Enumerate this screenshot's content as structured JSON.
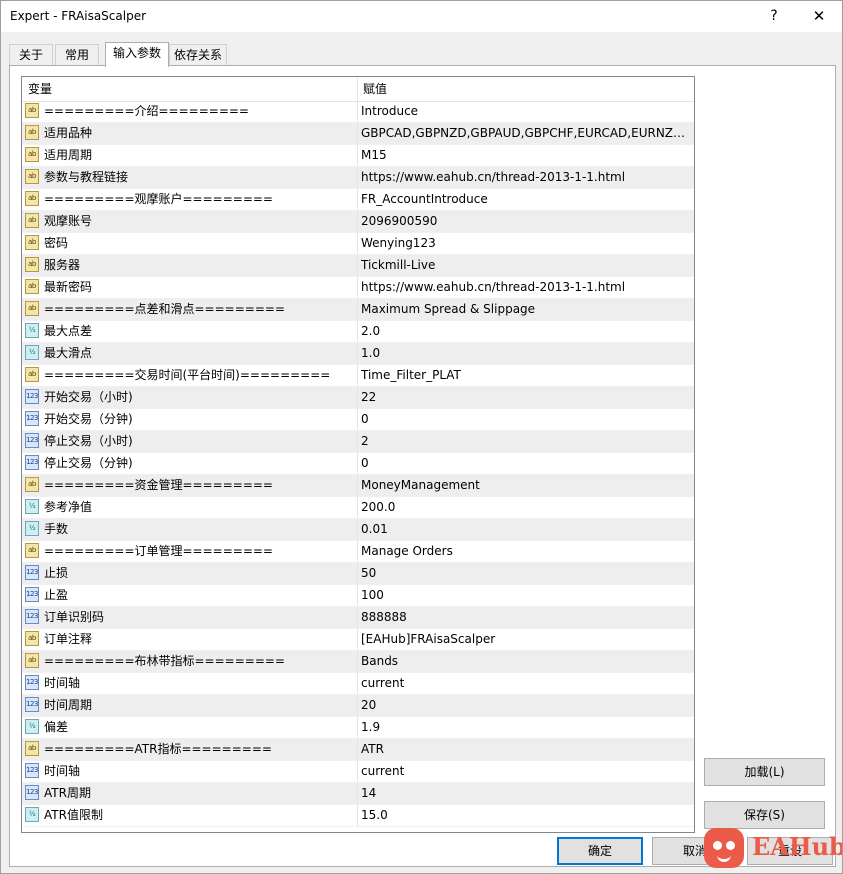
{
  "window": {
    "title": "Expert - FRAisaScalper",
    "help": "?",
    "close": "✕"
  },
  "tabs": [
    {
      "label": "关于"
    },
    {
      "label": "常用"
    },
    {
      "label": "输入参数",
      "active": true
    },
    {
      "label": "依存关系"
    }
  ],
  "grid": {
    "col_variable": "变量",
    "col_value": "赋值",
    "rows": [
      {
        "type": "str",
        "name": "=========介绍=========",
        "value": "Introduce"
      },
      {
        "type": "str",
        "name": "适用品种",
        "value": "GBPCAD,GBPNZD,GBPAUD,GBPCHF,EURCAD,EURNZD,..."
      },
      {
        "type": "str",
        "name": "适用周期",
        "value": "M15"
      },
      {
        "type": "str",
        "name": "参数与教程链接",
        "value": "https://www.eahub.cn/thread-2013-1-1.html"
      },
      {
        "type": "str",
        "name": "=========观摩账户=========",
        "value": "FR_AccountIntroduce"
      },
      {
        "type": "str",
        "name": "观摩账号",
        "value": "2096900590"
      },
      {
        "type": "str",
        "name": "密码",
        "value": "Wenying123"
      },
      {
        "type": "str",
        "name": "服务器",
        "value": "Tickmill-Live"
      },
      {
        "type": "str",
        "name": "最新密码",
        "value": "https://www.eahub.cn/thread-2013-1-1.html"
      },
      {
        "type": "str",
        "name": "=========点差和滑点=========",
        "value": "Maximum Spread & Slippage"
      },
      {
        "type": "dbl",
        "name": "最大点差",
        "value": "2.0"
      },
      {
        "type": "dbl",
        "name": "最大滑点",
        "value": "1.0"
      },
      {
        "type": "str",
        "name": "=========交易时间(平台时间)=========",
        "value": "Time_Filter_PLAT"
      },
      {
        "type": "int",
        "name": "开始交易（小时)",
        "value": "22"
      },
      {
        "type": "int",
        "name": "开始交易（分钟)",
        "value": "0"
      },
      {
        "type": "int",
        "name": "停止交易（小时)",
        "value": "2"
      },
      {
        "type": "int",
        "name": "停止交易（分钟)",
        "value": "0"
      },
      {
        "type": "str",
        "name": "=========资金管理=========",
        "value": "MoneyManagement"
      },
      {
        "type": "dbl",
        "name": "参考净值",
        "value": "200.0"
      },
      {
        "type": "dbl",
        "name": "手数",
        "value": "0.01"
      },
      {
        "type": "str",
        "name": "=========订单管理=========",
        "value": "Manage Orders"
      },
      {
        "type": "int",
        "name": "止损",
        "value": "50"
      },
      {
        "type": "int",
        "name": "止盈",
        "value": "100"
      },
      {
        "type": "int",
        "name": "订单识别码",
        "value": "888888"
      },
      {
        "type": "str",
        "name": "订单注释",
        "value": "[EAHub]FRAisaScalper"
      },
      {
        "type": "str",
        "name": "=========布林带指标=========",
        "value": "Bands"
      },
      {
        "type": "int",
        "name": "时间轴",
        "value": "current"
      },
      {
        "type": "int",
        "name": "时间周期",
        "value": "20"
      },
      {
        "type": "dbl",
        "name": "偏差",
        "value": "1.9"
      },
      {
        "type": "str",
        "name": "=========ATR指标=========",
        "value": "ATR"
      },
      {
        "type": "int",
        "name": "时间轴",
        "value": "current"
      },
      {
        "type": "int",
        "name": "ATR周期",
        "value": "14"
      },
      {
        "type": "dbl",
        "name": "ATR值限制",
        "value": "15.0"
      }
    ]
  },
  "icons": {
    "str": "ab",
    "int": "123",
    "dbl": "½"
  },
  "buttons": {
    "load": "加载(L)",
    "save": "保存(S)",
    "ok": "确定",
    "cancel": "取消",
    "reset": "重设"
  },
  "watermark": {
    "text": "EAHub"
  },
  "colors": {
    "accent": "#0078d7",
    "watermark": "#ec5a4a"
  }
}
